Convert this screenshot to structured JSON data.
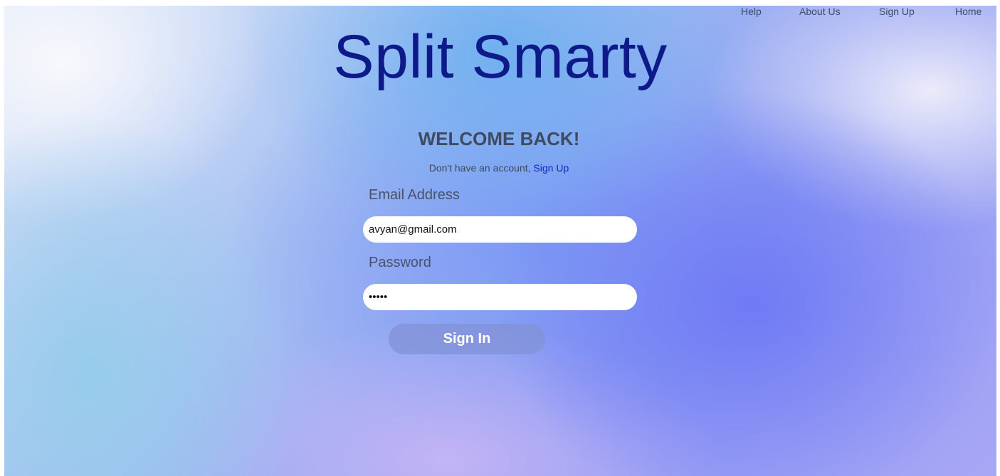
{
  "nav": {
    "items": [
      {
        "label": "Help"
      },
      {
        "label": "About Us"
      },
      {
        "label": "Sign Up"
      },
      {
        "label": "Home"
      }
    ]
  },
  "brand": {
    "title": "Split Smarty",
    "color": "#0e1a8a"
  },
  "login": {
    "heading": "WELCOME BACK!",
    "prompt": "Don't have an account,",
    "signup_link": "Sign Up",
    "email_label": "Email Address",
    "email_value": "avyan@gmail.com",
    "password_label": "Password",
    "password_value": "•••••",
    "submit_label": "Sign In"
  }
}
